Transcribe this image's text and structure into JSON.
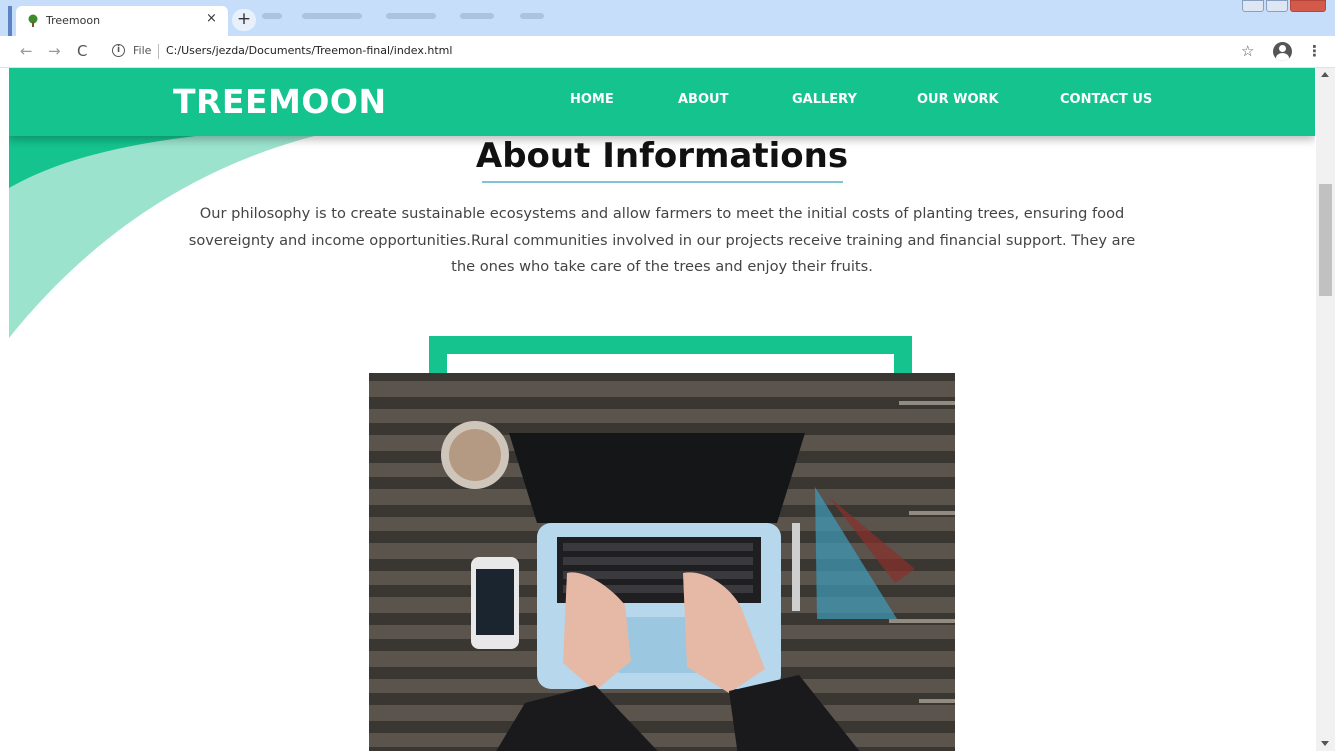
{
  "browser": {
    "tab_title": "Treemoon",
    "tab_close": "×",
    "new_tab": "+",
    "file_label": "File",
    "url": "C:/Users/jezda/Documents/Treemon-final/index.html",
    "back": "←",
    "forward": "→",
    "reload": "C",
    "star": "☆",
    "menu": "⋮"
  },
  "site": {
    "logo": "TREEMOON",
    "nav": [
      "HOME",
      "ABOUT",
      "GALLERY",
      "OUR WORK",
      "CONTACT US"
    ],
    "colors": {
      "brand": "#14c38e",
      "brand_light": "#9be3cd",
      "underline": "#7fc4d2"
    }
  },
  "about": {
    "title": "About Informations",
    "lines": [
      "Our philosophy is to create sustainable ecosystems and allow farmers to meet the initial costs of planting trees, ensuring food",
      "sovereignty and income opportunities.Rural communities involved in our projects receive training and financial support. They are",
      "the ones who take care of the trees and enjoy their fruits."
    ]
  }
}
